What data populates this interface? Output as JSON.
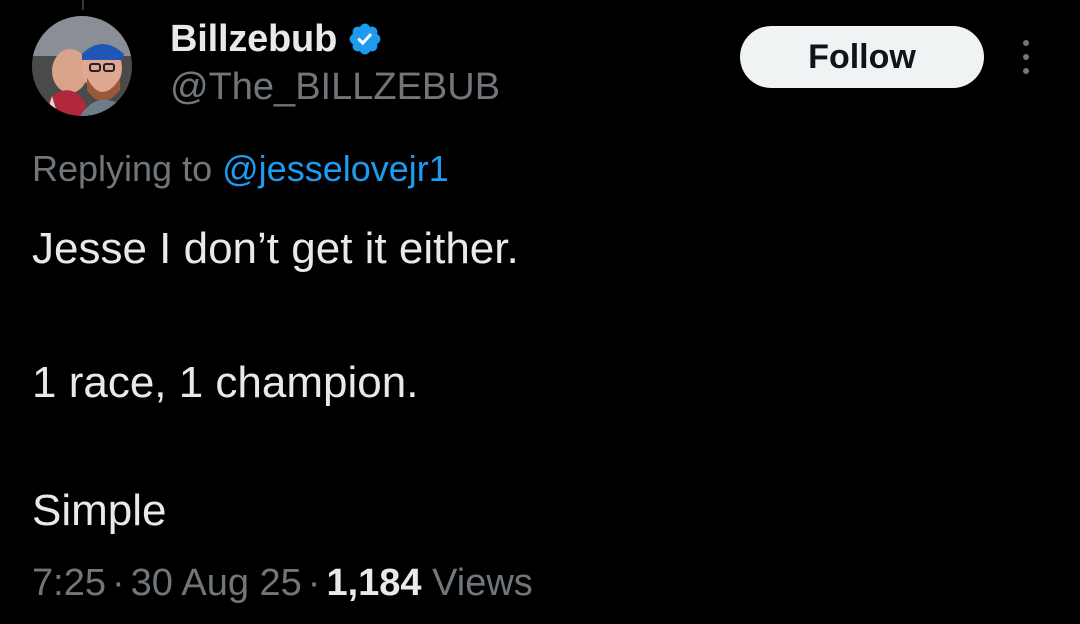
{
  "header": {
    "display_name": "Billzebub",
    "handle": "@The_BILLZEBUB",
    "follow_label": "Follow",
    "verified_icon": "verified-badge-icon",
    "more_icon": "more-vertical-icon"
  },
  "reply": {
    "prefix": "Replying to",
    "target": "@jesselovejr1"
  },
  "tweet": {
    "lines": [
      "Jesse I don’t get it either.",
      "1 race, 1 champion.",
      "Simple"
    ]
  },
  "meta": {
    "time": "7:25",
    "separator": "·",
    "date": "30 Aug 25",
    "views_count": "1,184",
    "views_label": "Views"
  },
  "colors": {
    "background": "#000000",
    "primary_text": "#e7e9ea",
    "secondary_text": "#71767b",
    "link": "#1d9bf0",
    "verified": "#1d9bf0",
    "follow_bg": "#eff3f4"
  }
}
